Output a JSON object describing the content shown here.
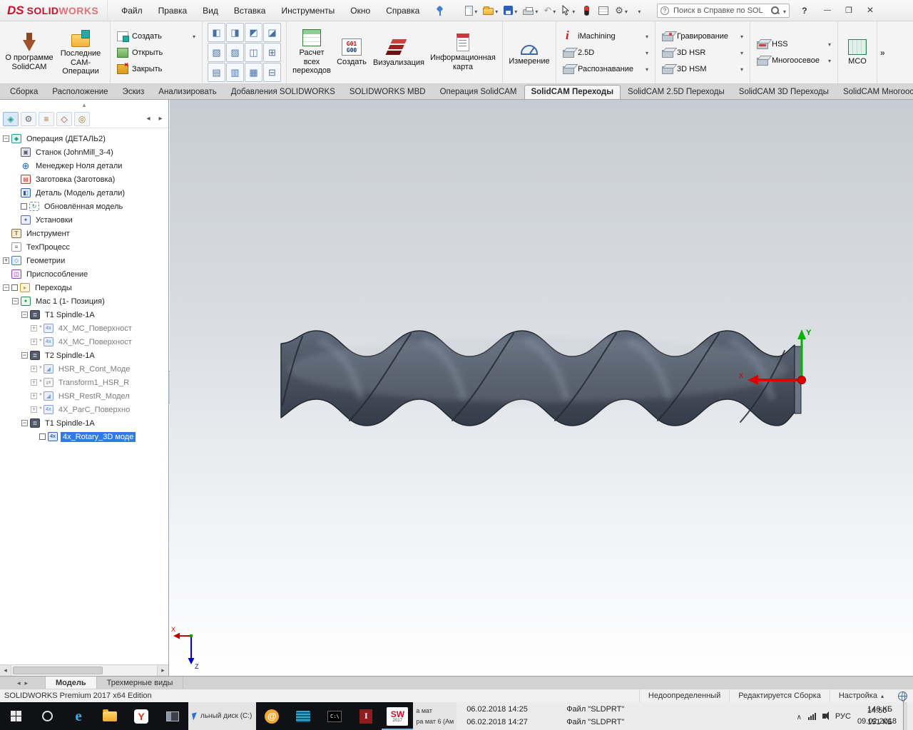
{
  "titlebar": {
    "brand_prefix": "DS",
    "brand_solid": "SOLID",
    "brand_works": "WORKS",
    "menus": [
      "Файл",
      "Правка",
      "Вид",
      "Вставка",
      "Инструменты",
      "Окно",
      "Справка"
    ],
    "search_value": "Поиск в Справке по SOL"
  },
  "ribbon": {
    "about_label": "О программе SolidCAM",
    "recent_label": "Последние CAM-Операции",
    "file_ops": [
      {
        "label": "Создать",
        "icon": "cam-new",
        "caret": true
      },
      {
        "label": "Открыть",
        "icon": "cam-open"
      },
      {
        "label": "Закрыть",
        "icon": "cam-close"
      }
    ],
    "calc_label": "Расчет всех переходов",
    "gcode_icon_line1": "G01",
    "gcode_icon_line2": "G00",
    "gcode_label": "Создать",
    "sim_label": "Визуализация",
    "info_label": "Информационная карта",
    "measure_label": "Измерение",
    "cam_col1": [
      {
        "label": "iMachining",
        "icon": "imachining",
        "caret": true
      },
      {
        "label": "2.5D",
        "icon": "cube",
        "caret": true
      },
      {
        "label": "Распознавание",
        "icon": "cube",
        "caret": true
      }
    ],
    "cam_col2": [
      {
        "label": "Гравирование",
        "icon": "engrave",
        "caret": true
      },
      {
        "label": "3D HSR",
        "icon": "cube",
        "caret": true
      },
      {
        "label": "3D HSM",
        "icon": "cube",
        "caret": true
      }
    ],
    "cam_col3": [
      {
        "label": "HSS",
        "icon": "hss",
        "caret": true
      },
      {
        "label": "Многоосевое",
        "icon": "multiaxis",
        "caret": true
      }
    ],
    "mco_label": "MCO",
    "overflow_label": "»"
  },
  "tabs": [
    {
      "label": "Сборка"
    },
    {
      "label": "Расположение"
    },
    {
      "label": "Эскиз"
    },
    {
      "label": "Анализировать"
    },
    {
      "label": "Добавления SOLIDWORKS"
    },
    {
      "label": "SOLIDWORKS MBD"
    },
    {
      "label": "Операция  SolidCAM"
    },
    {
      "label": "SolidCAM Переходы",
      "active": true
    },
    {
      "label": "SolidCAM 2.5D Переходы"
    },
    {
      "label": "SolidCAM 3D Переходы"
    },
    {
      "label": "SolidCAM Многоосева..."
    }
  ],
  "tree": [
    {
      "indent": 0,
      "expander": "minus",
      "icon": "operation",
      "label": "Операция (ДЕТАЛЬ2)"
    },
    {
      "indent": 1,
      "icon": "machine",
      "label": "Станок (JohnMill_3-4)"
    },
    {
      "indent": 1,
      "icon": "zero",
      "label": "Менеджер Ноля детали"
    },
    {
      "indent": 1,
      "icon": "stock",
      "label": "Заготовка (Заготовка)"
    },
    {
      "indent": 1,
      "icon": "part",
      "label": "Деталь (Модель детали)"
    },
    {
      "indent": 1,
      "checkbox": true,
      "icon": "updated",
      "label": "Обновлённая модель"
    },
    {
      "indent": 1,
      "icon": "setup",
      "label": "Установки"
    },
    {
      "indent": 0,
      "icon": "tool",
      "label": "Инструмент"
    },
    {
      "indent": 0,
      "icon": "process",
      "label": "ТехПроцесс"
    },
    {
      "indent": 0,
      "expander": "plus",
      "icon": "geometry",
      "label": "Геометрии"
    },
    {
      "indent": 0,
      "icon": "fixture",
      "label": "Приспособление"
    },
    {
      "indent": 0,
      "expander": "minus",
      "checkbox": true,
      "icon": "transitions",
      "label": "Переходы"
    },
    {
      "indent": 1,
      "expander": "minus",
      "icon": "mac",
      "label": "Мас 1 (1- Позиция)"
    },
    {
      "indent": 2,
      "expander": "minus",
      "icon": "spindle",
      "label": "T1 Spindle-1A"
    },
    {
      "indent": 3,
      "expander": "plus",
      "star": true,
      "icon": "op4x",
      "label": "4X_MC_Поверхност",
      "grayed": true
    },
    {
      "indent": 3,
      "expander": "plus",
      "star": true,
      "icon": "op4x",
      "label": "4X_MC_Поверхност",
      "grayed": true
    },
    {
      "indent": 2,
      "expander": "minus",
      "icon": "spindle",
      "label": "T2 Spindle-1A"
    },
    {
      "indent": 3,
      "expander": "plus",
      "star": true,
      "icon": "hsr",
      "label": "HSR_R_Cont_Моде",
      "grayed": true
    },
    {
      "indent": 3,
      "expander": "plus",
      "star": true,
      "icon": "transform",
      "label": "Transform1_HSR_R",
      "grayed": true
    },
    {
      "indent": 3,
      "expander": "plus",
      "star": true,
      "icon": "hsr",
      "label": "HSR_RestR_Модел",
      "grayed": true
    },
    {
      "indent": 3,
      "expander": "plus",
      "star": true,
      "icon": "op4x",
      "label": "4X_ParC_Поверхно",
      "grayed": true
    },
    {
      "indent": 2,
      "expander": "minus",
      "icon": "spindle",
      "label": "T1 Spindle-1A"
    },
    {
      "indent": 3,
      "checkbox": true,
      "icon": "op4x",
      "label": "4x_Rotary_3D моде",
      "selected": true
    }
  ],
  "viewport": {
    "triad_right_y": "Y",
    "triad_right_x": "X",
    "triad_corner_x": "X",
    "triad_corner_z": "Z"
  },
  "doc_tabs": [
    {
      "label": "Модель",
      "active": true
    },
    {
      "label": "Трехмерные виды"
    }
  ],
  "statusbar": {
    "edition": "SOLIDWORKS Premium 2017 x64 Edition",
    "state": "Недоопределенный",
    "mode": "Редактируется Сборка",
    "custom_label": "Настройка"
  },
  "taskbar": {
    "explorer_fragment": "льный диск (C:)",
    "fragments": [
      "а мат",
      "ра мат 6 (Ам"
    ],
    "sw_icon_line1": "SW",
    "sw_icon_line2": "2017",
    "console_label": "C:\\",
    "files": [
      {
        "date": "06.02.2018 14:25",
        "type": "Файл \"SLDPRT\"",
        "size": "146 КБ"
      },
      {
        "date": "06.02.2018 14:27",
        "type": "Файл \"SLDPRT\"",
        "size": "151 КБ"
      }
    ],
    "lang": "РУС",
    "time": "14:50",
    "date": "09.02.2018"
  }
}
